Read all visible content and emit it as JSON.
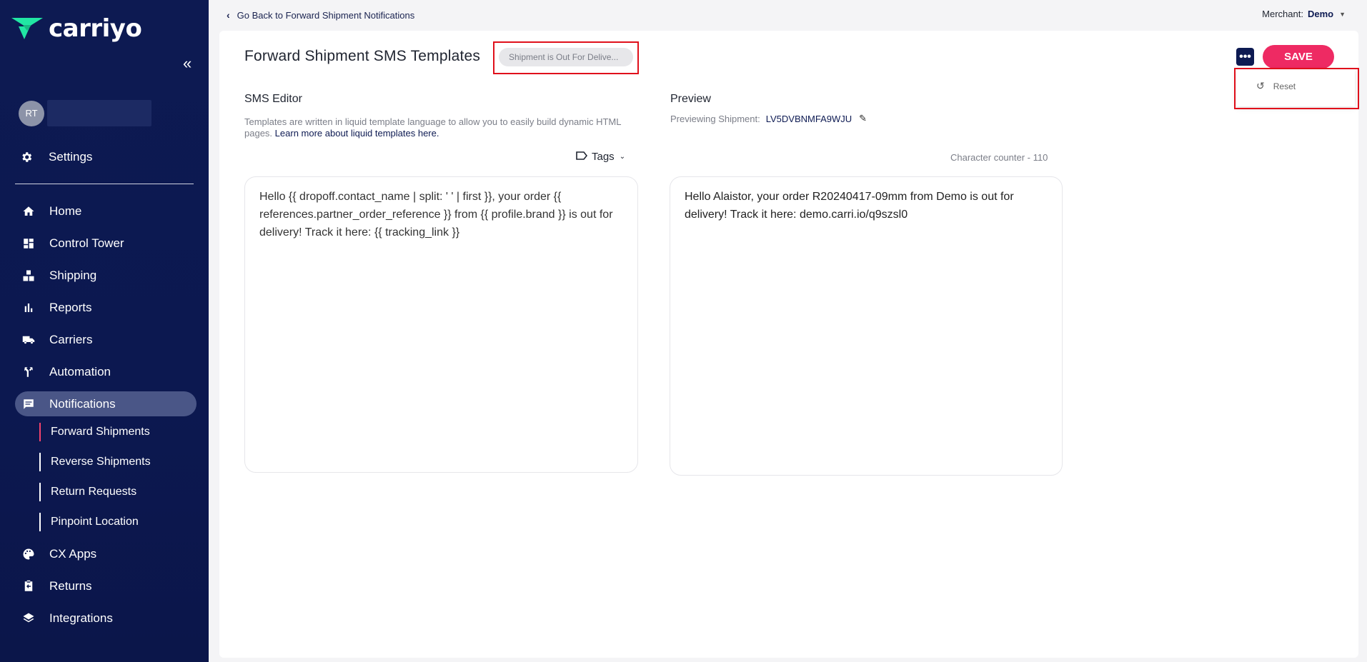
{
  "brand": {
    "name": "carriyo",
    "accent_color": "#ee2a63",
    "nav_bg": "#0d1a52",
    "logo_green": "#21e6a4"
  },
  "user": {
    "initials": "RT"
  },
  "sidebar": {
    "settings_label": "Settings",
    "items": [
      {
        "label": "Home",
        "icon": "home-icon"
      },
      {
        "label": "Control Tower",
        "icon": "dashboard-icon"
      },
      {
        "label": "Shipping",
        "icon": "boxes-icon"
      },
      {
        "label": "Reports",
        "icon": "bar-chart-icon"
      },
      {
        "label": "Carriers",
        "icon": "truck-icon"
      },
      {
        "label": "Automation",
        "icon": "fork-icon"
      },
      {
        "label": "Notifications",
        "icon": "chat-icon"
      }
    ],
    "sub_items": [
      {
        "label": "Forward Shipments"
      },
      {
        "label": "Reverse Shipments"
      },
      {
        "label": "Return Requests"
      },
      {
        "label": "Pinpoint Location"
      }
    ],
    "items_after": [
      {
        "label": "CX Apps",
        "icon": "palette-icon"
      },
      {
        "label": "Returns",
        "icon": "return-icon"
      },
      {
        "label": "Integrations",
        "icon": "layers-icon"
      }
    ]
  },
  "topbar": {
    "back_label": "Go Back to Forward Shipment Notifications",
    "merchant_label": "Merchant:",
    "merchant_value": "Demo"
  },
  "header": {
    "title": "Forward Shipment SMS Templates",
    "template_select": "Shipment is Out For Delive...",
    "more_label": "•••",
    "save_label": "SAVE",
    "reset_label": "Reset"
  },
  "editor": {
    "title": "SMS Editor",
    "helper_text": "Templates are written in liquid template language to allow you to easily build dynamic HTML pages.",
    "helper_link": "Learn more about liquid templates here.",
    "tags_label": "Tags",
    "content": "Hello {{ dropoff.contact_name | split: ' ' | first }}, your order {{ references.partner_order_reference }} from {{ profile.brand }} is out for delivery! Track it here: {{ tracking_link }}"
  },
  "preview": {
    "title": "Preview",
    "previewing_label": "Previewing Shipment:",
    "shipment_id": "LV5DVBNMFA9WJU",
    "char_counter": "Character counter - 110",
    "content": "Hello Alaistor, your order R20240417-09mm from Demo is out for delivery! Track it here: demo.carri.io/q9szsl0"
  }
}
